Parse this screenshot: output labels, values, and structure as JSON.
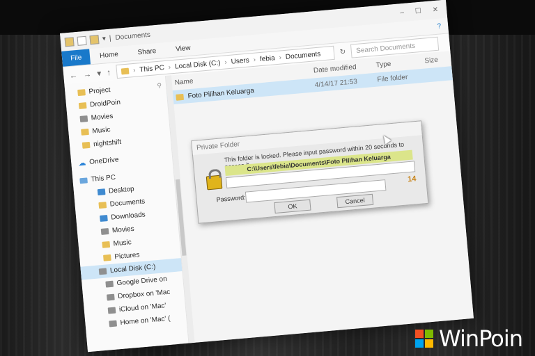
{
  "window": {
    "title": "Documents",
    "controls": [
      "–",
      "☐",
      "✕"
    ]
  },
  "ribbon": {
    "file": "File",
    "tabs": [
      "Home",
      "Share",
      "View"
    ],
    "help": "?"
  },
  "address": {
    "crumbs": [
      "This PC",
      "Local Disk (C:)",
      "Users",
      "febia",
      "Documents"
    ],
    "search_placeholder": "Search Documents"
  },
  "columns": {
    "name": "Name",
    "date": "Date modified",
    "type": "Type",
    "size": "Size"
  },
  "files": [
    {
      "name": "Foto Pilihan Keluarga",
      "date": "4/14/17 21:53",
      "type": "File folder"
    }
  ],
  "sidebar": {
    "quick": [
      "Project",
      "DroidPoin",
      "Movies",
      "Music",
      "nightshift"
    ],
    "onedrive": "OneDrive",
    "thispc": "This PC",
    "pc_items": [
      "Desktop",
      "Documents",
      "Downloads",
      "Movies",
      "Music",
      "Pictures"
    ],
    "local_disk": "Local Disk (C:)",
    "mounts": [
      "Google Drive on",
      "Dropbox on 'Mac",
      "iCloud on 'Mac'",
      "Home on 'Mac' ("
    ]
  },
  "dialog": {
    "title": "Private Folder",
    "message": "This folder is locked. Please input password within 20 seconds to access it.",
    "path": "C:\\Users\\febia\\Documents\\Foto Pilihan Keluarga",
    "countdown": "14",
    "password_label": "Password:",
    "ok": "OK",
    "cancel": "Cancel"
  },
  "watermark": "WinPoin",
  "colors": {
    "accent": "#1979ca",
    "selection": "#cde5f7",
    "highlight": "#dbe58a"
  }
}
